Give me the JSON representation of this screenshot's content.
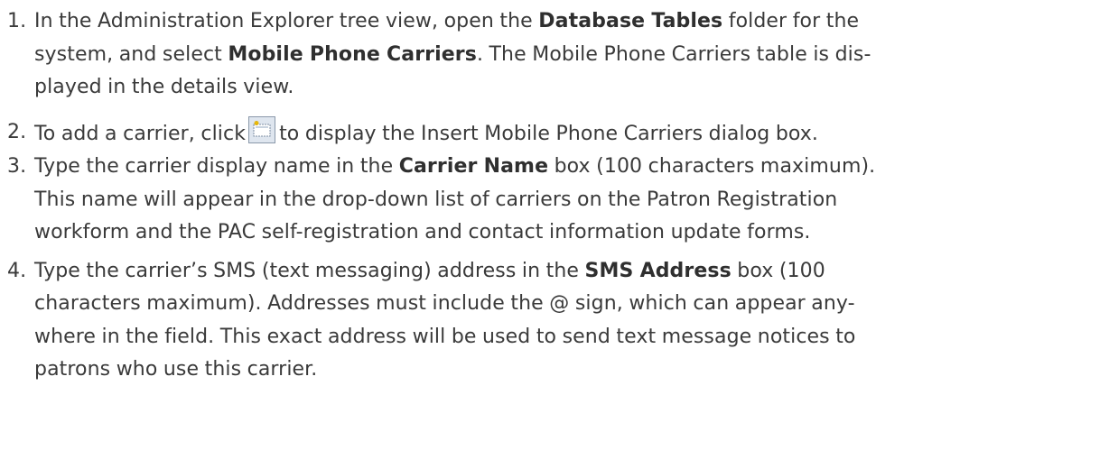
{
  "steps": [
    {
      "number": "1.",
      "lines": [
        {
          "t1": "In the Administration Explorer tree view, open the ",
          "b1": "Database Tables",
          "t2": " folder for the"
        },
        {
          "t1": "system, and select ",
          "b1": "Mobile Phone Carriers",
          "t2": ". The Mobile Phone Carriers table is dis-"
        },
        {
          "t1": "played in the details view."
        }
      ]
    },
    {
      "number": "2.",
      "pre": "To add a carrier, click",
      "icon": "insert-record-icon",
      "post": "to display the Insert Mobile Phone Carriers dialog box."
    },
    {
      "number": "3.",
      "lines": [
        {
          "t1": "Type the carrier display name in the ",
          "b1": "Carrier Name",
          "t2": " box (100 characters maximum)."
        },
        {
          "t1": "This name will appear in the drop-down list of carriers on the Patron Registration"
        },
        {
          "t1": "workform and the PAC self-registration and contact information update forms."
        }
      ]
    },
    {
      "number": "4.",
      "lines": [
        {
          "t1": "Type the carrier’s SMS (text messaging) address in the ",
          "b1": "SMS Address",
          "t2": " box (100"
        },
        {
          "t1": "characters maximum). Addresses must include the @ sign, which can appear any-"
        },
        {
          "t1": "where in the field. This exact address will be used to send text message notices to"
        },
        {
          "t1": "patrons who use this carrier."
        }
      ]
    }
  ]
}
